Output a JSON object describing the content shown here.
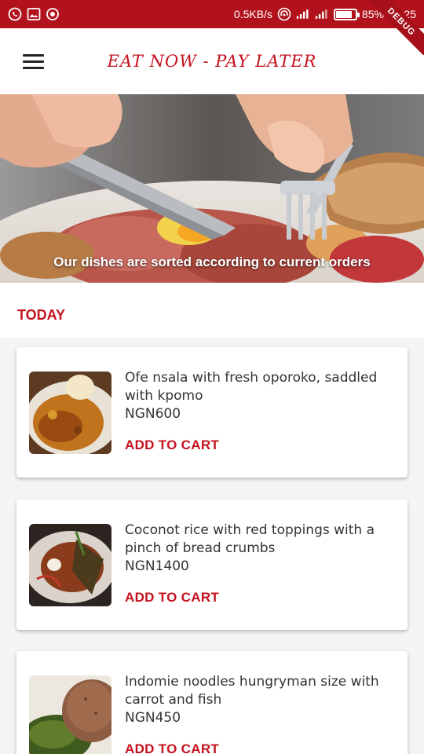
{
  "status_bar": {
    "network_speed": "0.5KB/s",
    "battery_percent": "85%",
    "time": "23:25",
    "battery_level": 0.85,
    "icons": [
      "whatsapp-icon",
      "image-icon",
      "record-icon",
      "hotspot-icon",
      "signal-icon",
      "signal-4g-icon",
      "battery-icon"
    ]
  },
  "app_bar": {
    "title": "EAT NOW - PAY LATER",
    "debug_banner": "DEBUG",
    "menu_icon": "hamburger-menu-icon"
  },
  "hero": {
    "caption": "Our dishes are sorted according to current orders"
  },
  "section": {
    "title": "TODAY"
  },
  "dishes": [
    {
      "name": "Ofe nsala with fresh oporoko, saddled with kpomo",
      "price": "NGN600",
      "action": "ADD TO CART"
    },
    {
      "name": "Coconot rice with red toppings with a pinch of bread crumbs",
      "price": "NGN1400",
      "action": "ADD TO CART"
    },
    {
      "name": "Indomie noodles hungryman size with carrot and fish",
      "price": "NGN450",
      "action": "ADD TO CART"
    }
  ],
  "colors": {
    "brand_red": "#c4121f",
    "status_bar": "#b1121c"
  }
}
